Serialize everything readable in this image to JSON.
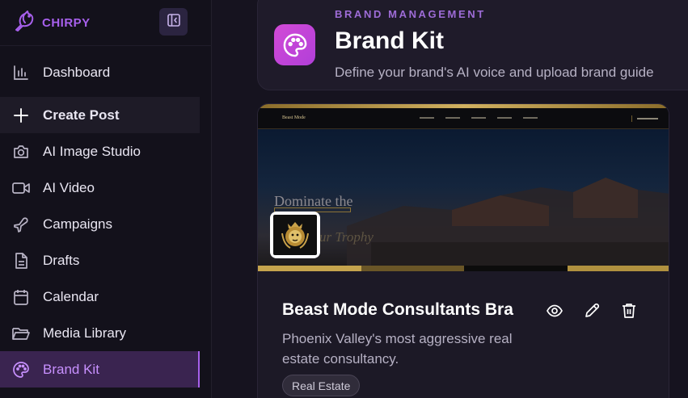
{
  "app": {
    "logo_text": "CHIRPY",
    "accent_color": "#a760ec"
  },
  "sidebar": {
    "collapse_icon": "sidebar-collapse-icon",
    "items": [
      {
        "label": "Dashboard",
        "icon": "bar-chart-icon"
      },
      {
        "label": "Create Post",
        "icon": "plus-icon"
      },
      {
        "label": "AI Image Studio",
        "icon": "camera-icon"
      },
      {
        "label": "AI Video",
        "icon": "video-icon"
      },
      {
        "label": "Campaigns",
        "icon": "plane-icon"
      },
      {
        "label": "Drafts",
        "icon": "document-icon"
      },
      {
        "label": "Calendar",
        "icon": "calendar-icon"
      },
      {
        "label": "Media Library",
        "icon": "folder-icon"
      },
      {
        "label": "Brand Kit",
        "icon": "palette-icon",
        "active": true
      }
    ]
  },
  "header": {
    "eyebrow": "BRAND MANAGEMENT",
    "title": "Brand Kit",
    "subtitle": "Define your brand's AI voice and upload brand guide",
    "icon": "palette-icon"
  },
  "brand_card": {
    "name": "Beast Mode Consultants Bra",
    "description": "Phoenix Valley's most aggressive real estate consultancy.",
    "tag": "Real Estate",
    "preview": {
      "site_name": "Beast Mode",
      "hero_line1": "Dominate the",
      "hero_line2": "ur Trophy"
    },
    "colors": [
      "#c5a44d",
      "#6a5627",
      "#0c0c0c",
      "#b0913f"
    ],
    "actions": [
      "view-icon",
      "edit-icon",
      "delete-icon"
    ]
  }
}
